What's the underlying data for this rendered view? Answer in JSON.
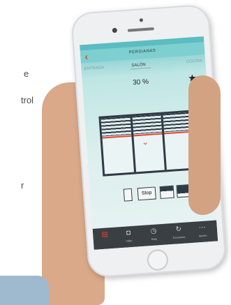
{
  "background_fragments": [
    "e",
    "trol",
    "r"
  ],
  "app": {
    "title": "PERSIANAS",
    "back_icon": "chevron-left-icon",
    "tabs": [
      "ENTRADA",
      "SALÓN",
      "COCINA"
    ],
    "selected_tab": "SALÓN",
    "position_label": "30 %",
    "favorite_icon": "star-icon",
    "controls": {
      "stop_label": "Stop"
    },
    "tabbar": [
      {
        "icon": "shutter-icon",
        "label": ""
      },
      {
        "icon": "camera-icon",
        "label": "Video"
      },
      {
        "icon": "clock-icon",
        "label": "Reloj"
      },
      {
        "icon": "refresh-icon",
        "label": "Escenarios"
      },
      {
        "icon": "settings-icon",
        "label": "Ajustes"
      }
    ]
  },
  "colors": {
    "accent": "#e4462d",
    "screen_top": "#6ec5c9",
    "frame": "#2f3b45",
    "tabbar": "#3a3f44"
  }
}
